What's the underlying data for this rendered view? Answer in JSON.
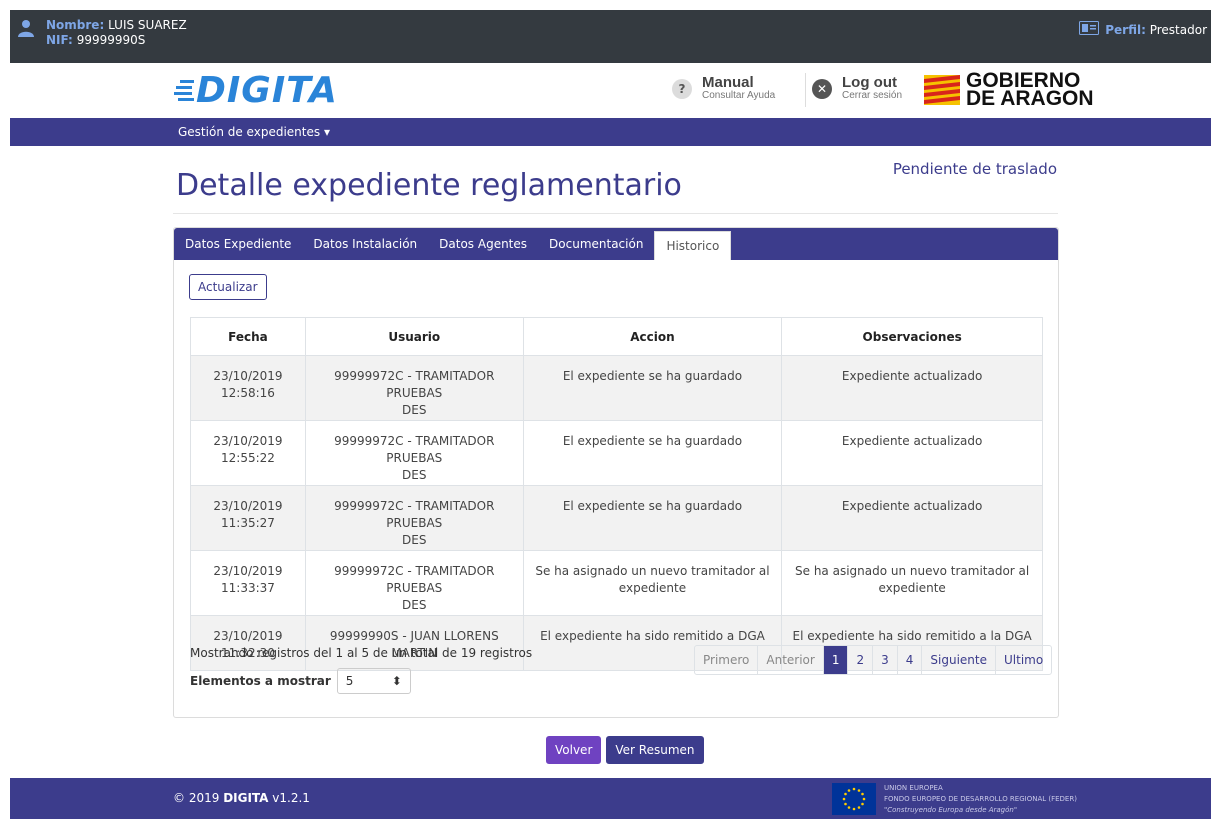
{
  "topbar": {
    "name_label": "Nombre:",
    "name_value": "LUIS SUAREZ",
    "nif_label": "NIF:",
    "nif_value": "99999990S",
    "profile_label": "Perfil:",
    "profile_value": "Prestador"
  },
  "header": {
    "logo": "DIGITA",
    "manual_title": "Manual",
    "manual_sub": "Consultar Ayuda",
    "logout_title": "Log out",
    "logout_sub": "Cerrar sesión",
    "gov_line1": "GOBIERNO",
    "gov_line2": "DE ARAGON"
  },
  "nav": {
    "menu_label": "Gestión de expedientes"
  },
  "page": {
    "title": "Detalle expediente reglamentario",
    "state": "Pendiente de traslado"
  },
  "tabs": [
    "Datos Expediente",
    "Datos Instalación",
    "Datos Agentes",
    "Documentación",
    "Historico"
  ],
  "refresh_label": "Actualizar",
  "table": {
    "headers": [
      "Fecha",
      "Usuario",
      "Accion",
      "Observaciones"
    ],
    "rows": [
      {
        "date": "23/10/2019",
        "time": "12:58:16",
        "user1": "99999972C - TRAMITADOR PRUEBAS",
        "user2": "DES",
        "action1": "El expediente se ha guardado",
        "action2": "",
        "obs1": "Expediente actualizado",
        "obs2": ""
      },
      {
        "date": "23/10/2019",
        "time": "12:55:22",
        "user1": "99999972C - TRAMITADOR PRUEBAS",
        "user2": "DES",
        "action1": "El expediente se ha guardado",
        "action2": "",
        "obs1": "Expediente actualizado",
        "obs2": ""
      },
      {
        "date": "23/10/2019",
        "time": "11:35:27",
        "user1": "99999972C - TRAMITADOR PRUEBAS",
        "user2": "DES",
        "action1": "El expediente se ha guardado",
        "action2": "",
        "obs1": "Expediente actualizado",
        "obs2": ""
      },
      {
        "date": "23/10/2019",
        "time": "11:33:37",
        "user1": "99999972C - TRAMITADOR PRUEBAS",
        "user2": "DES",
        "action1": "Se ha asignado un nuevo tramitador al",
        "action2": "expediente",
        "obs1": "Se ha asignado un nuevo tramitador al",
        "obs2": "expediente"
      },
      {
        "date": "23/10/2019",
        "time": "11:32:30",
        "user1": "99999990S - JUAN LLORENS",
        "user2": "MARTIN",
        "action1": "El expediente ha sido remitido a DGA",
        "action2": "",
        "obs1": "El expediente ha sido remitido a la DGA",
        "obs2": ""
      }
    ]
  },
  "pagination_info": "Mostrando registros del 1 al 5 de un total de 19 registros",
  "per_page": {
    "label": "Elementos a mostrar",
    "value": "5"
  },
  "pager": {
    "first": "Primero",
    "prev": "Anterior",
    "pages": [
      "1",
      "2",
      "3",
      "4"
    ],
    "next": "Siguiente",
    "last": "Ultimo"
  },
  "buttons": {
    "back": "Volver",
    "summary": "Ver Resumen"
  },
  "footer": {
    "copyright": "© 2019",
    "brand": "DIGITA",
    "version": "v1.2.1",
    "eu_line1": "UNION EUROPEA",
    "eu_line2": "FONDO EUROPEO DE DESARROLLO REGIONAL (FEDER)",
    "eu_line3": "\"Construyendo Europa desde Aragón\""
  },
  "colors": {
    "primary": "#3c3c8c",
    "topbar": "#343a40",
    "logo": "#2a84d8",
    "accent": "#6f42c1"
  },
  "icons": [
    "user-icon",
    "id-card-icon",
    "help-icon",
    "close-icon",
    "caret-down-icon",
    "eu-flag-icon"
  ]
}
